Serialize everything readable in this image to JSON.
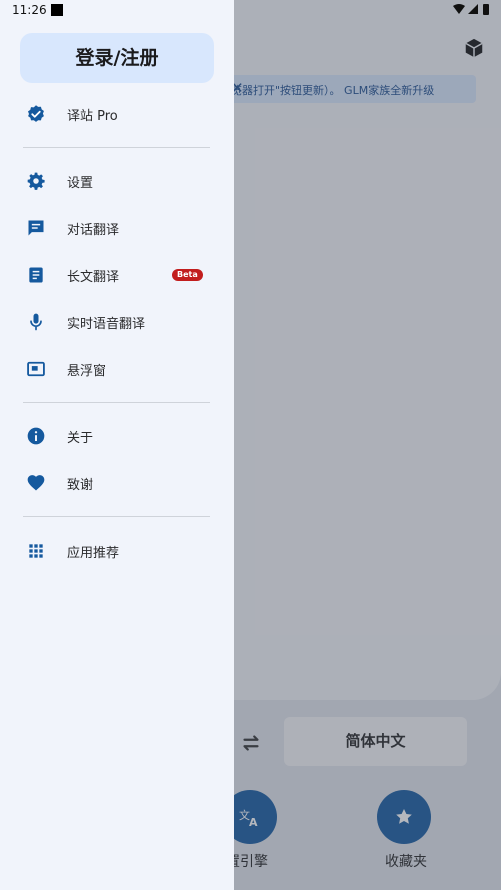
{
  "status_bar": {
    "time": "11:26"
  },
  "drawer": {
    "login_label": "登录/注册",
    "items": [
      {
        "label": "译站 Pro",
        "icon": "verified-badge-icon"
      },
      {
        "label": "设置",
        "icon": "gear-icon"
      },
      {
        "label": "对话翻译",
        "icon": "chat-icon"
      },
      {
        "label": "长文翻译",
        "icon": "document-icon",
        "badge": "Beta"
      },
      {
        "label": "实时语音翻译",
        "icon": "microphone-icon"
      },
      {
        "label": "悬浮窗",
        "icon": "floating-window-icon"
      },
      {
        "label": "关于",
        "icon": "info-icon"
      },
      {
        "label": "致谢",
        "icon": "heart-icon"
      },
      {
        "label": "应用推荐",
        "icon": "apps-grid-icon"
      }
    ]
  },
  "background": {
    "marquee": "览器打开\"按钮更新）。   GLM家族全新升级",
    "language": "简体中文",
    "fab_left_label": "置引擎",
    "fab_right_label": "收藏夹"
  },
  "colors": {
    "accent": "#15599e",
    "drawer_bg": "#f1f4fb",
    "login_bg": "#d8e7fd",
    "beta": "#c21d1d"
  }
}
